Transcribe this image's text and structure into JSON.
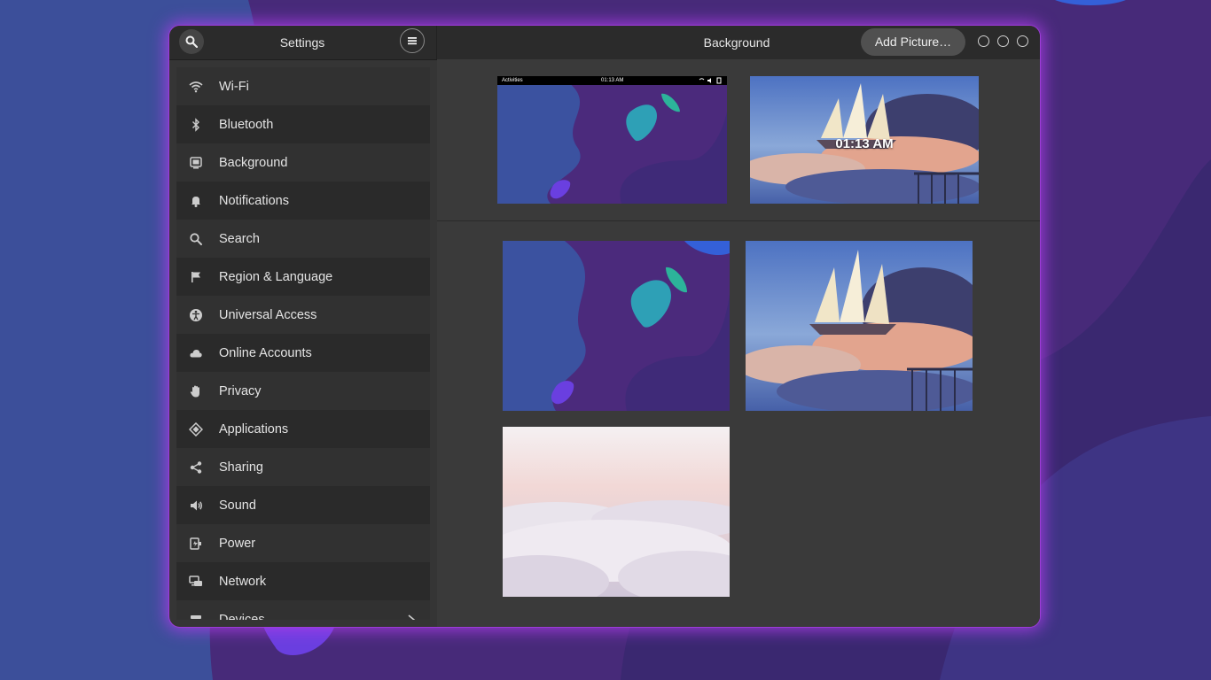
{
  "colors": {
    "window_bg": "#353535",
    "sidebar_bg": "#313131",
    "titlebar_bg": "#2b2b2b",
    "accent_glow": "#a03cdc",
    "wallpaper_blue": "#3c4f9a",
    "wallpaper_purple": "#4a2a78"
  },
  "titlebar": {
    "left_title": "Settings",
    "main_title": "Background",
    "add_picture_label": "Add Picture…",
    "search_icon": "search-icon",
    "menu_icon": "hamburger-menu-icon",
    "window_controls": [
      "minimize",
      "maximize",
      "close"
    ]
  },
  "sidebar": {
    "items": [
      {
        "label": "Wi-Fi",
        "icon": "wifi-icon"
      },
      {
        "label": "Bluetooth",
        "icon": "bluetooth-icon"
      },
      {
        "label": "Background",
        "icon": "background-icon"
      },
      {
        "label": "Notifications",
        "icon": "bell-icon"
      },
      {
        "label": "Search",
        "icon": "search-icon"
      },
      {
        "label": "Region & Language",
        "icon": "flag-icon"
      },
      {
        "label": "Universal Access",
        "icon": "accessibility-icon"
      },
      {
        "label": "Online Accounts",
        "icon": "cloud-icon"
      },
      {
        "label": "Privacy",
        "icon": "hand-icon"
      },
      {
        "label": "Applications",
        "icon": "applications-icon"
      },
      {
        "label": "Sharing",
        "icon": "share-icon"
      },
      {
        "label": "Sound",
        "icon": "speaker-icon"
      },
      {
        "label": "Power",
        "icon": "power-icon"
      },
      {
        "label": "Network",
        "icon": "network-icon"
      },
      {
        "label": "Devices",
        "icon": "devices-icon"
      }
    ]
  },
  "preview": {
    "desktop_topbar": {
      "activities": "Activities",
      "clock": "01:13 AM"
    },
    "lockscreen_clock": "01:13 AM"
  },
  "wallpapers": [
    {
      "name": "abstract-shapes"
    },
    {
      "name": "sky-ship"
    },
    {
      "name": "clouds"
    }
  ]
}
